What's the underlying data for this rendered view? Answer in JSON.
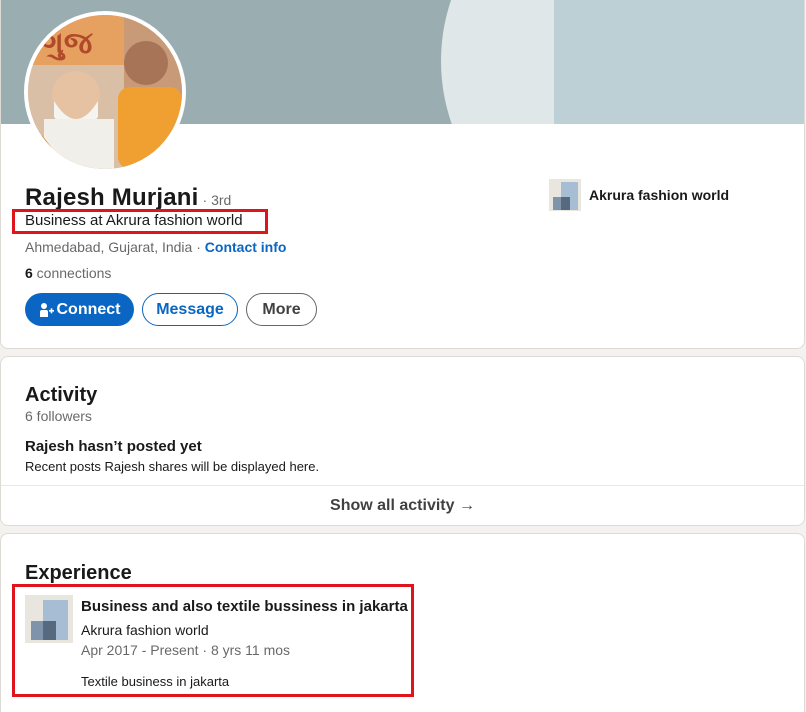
{
  "profile": {
    "name": "Rajesh Murjani",
    "degree": "· 3rd",
    "headline": "Business at Akrura fashion world",
    "location": "Ahmedabad, Gujarat, India · ",
    "contact_info": "Contact info",
    "connections_count": "6",
    "connections_label": " connections",
    "company": "Akrura fashion world",
    "buttons": {
      "connect": "Connect",
      "message": "Message",
      "more": "More"
    }
  },
  "activity": {
    "title": "Activity",
    "followers": "6 followers",
    "empty_title": "Rajesh hasn’t posted yet",
    "empty_sub": "Recent posts Rajesh shares will be displayed here.",
    "show_all": "Show all activity →"
  },
  "experience": {
    "title": "Experience",
    "items": [
      {
        "role": "Business and also textile bussiness in jakarta",
        "company": "Akrura fashion world",
        "dates": "Apr 2017 - Present · 8 yrs 11 mos",
        "description": "Textile business in jakarta"
      }
    ]
  },
  "colors": {
    "accent": "#0a66c2",
    "highlight_box": "#e0141d",
    "banner": "#9aaeb2"
  },
  "icons": {
    "connect": "add-person-icon",
    "company_logo": "company-logo-icon"
  }
}
